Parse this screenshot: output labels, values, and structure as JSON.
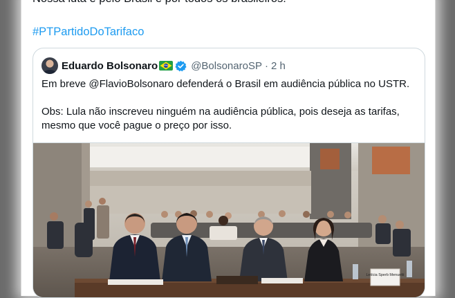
{
  "post": {
    "text_line_partial": "Nossa luta é pelo Brasil e por todos os brasileiros!",
    "hashtag": "#PTPartidoDoTarifaco"
  },
  "quoted": {
    "display_name": "Eduardo Bolsonaro",
    "flag_icon": "brazil-flag-emoji",
    "verified_icon": "verified-badge-icon",
    "handle": "@BolsonaroSP",
    "separator": "·",
    "time": "2 h",
    "text_line1": "Em breve @FlavioBolsonaro defenderá o Brasil em audiência pública no USTR.",
    "text_line2": "Obs: Lula não inscreveu ninguém na audiência pública, pois deseja as tarifas,",
    "text_line3": "mesmo que você pague o preço por isso.",
    "photo_nameplate": "Letícia Sperb Menuetti"
  },
  "colors": {
    "link": "#1d9bf0",
    "text": "#0f1419",
    "muted": "#536471",
    "border": "#cfd9de",
    "verified": "#1d9bf0",
    "background": "#6b6b6b"
  }
}
